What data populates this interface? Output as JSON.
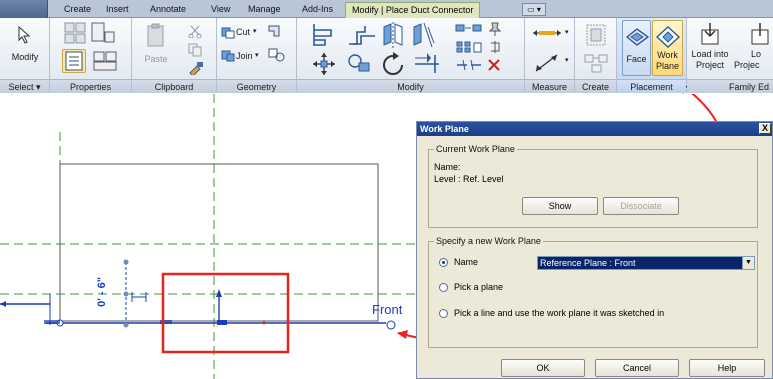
{
  "ribbon_tabs": {
    "create": "Create",
    "insert": "Insert",
    "annotate": "Annotate",
    "view": "View",
    "manage": "Manage",
    "addins": "Add-Ins",
    "contextual": "Modify | Place Duct Connector",
    "dropdown": "▭ ▾"
  },
  "panels": {
    "select": "Select ▾",
    "properties": "Properties",
    "clipboard": "Clipboard",
    "geometry": "Geometry",
    "modify": "Modify",
    "measure": "Measure",
    "create": "Create",
    "placement": "Placement",
    "family_editor": "Family Ed"
  },
  "buttons": {
    "modify": "Modify",
    "paste": "Paste",
    "cut": "Cut",
    "join": "Join",
    "face": "Face",
    "work_plane_1": "Work",
    "work_plane_2": "Plane",
    "load_into_1": "Load into",
    "load_into_2": "Project",
    "load_into_b1": "Lo",
    "load_into_b2": "Projec"
  },
  "drawing": {
    "view_label": "Front",
    "dimension": "0' - 6\""
  },
  "dialog": {
    "title": "Work Plane",
    "close": "X",
    "current_group": "Current Work Plane",
    "name_label": "Name:",
    "level_label": "Level : Ref. Level",
    "show": "Show",
    "dissociate": "Dissociate",
    "specify_group": "Specify a new Work Plane",
    "opt_name": "Name",
    "opt_name_value": "Reference Plane : Front",
    "opt_pick_plane": "Pick a plane",
    "opt_pick_line": "Pick a line and use the work plane it was sketched in",
    "ok": "OK",
    "cancel": "Cancel",
    "help": "Help"
  },
  "colors": {
    "annotation_red": "#e8241e",
    "ref_plane_green": "#3a9a3a",
    "dimension_blue": "#1a3fb5",
    "ribbon_highlight": "#c4d6ef"
  }
}
